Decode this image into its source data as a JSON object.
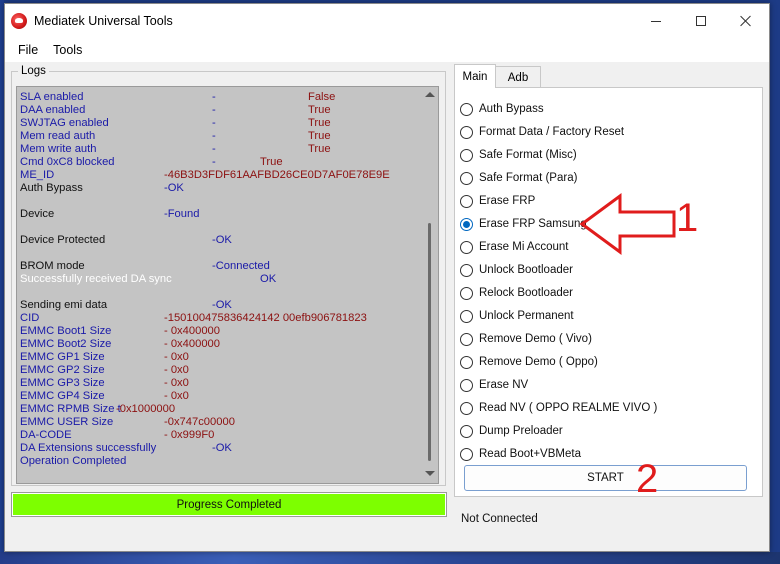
{
  "window": {
    "title": "Mediatek Universal Tools"
  },
  "menu": {
    "items": [
      {
        "label": "File"
      },
      {
        "label": "Tools"
      }
    ]
  },
  "logs": {
    "legend": "Logs",
    "lines": [
      {
        "a": "SLA enabled",
        "b": "-",
        "c": "False",
        "ca": "c-blue",
        "cb": "c-blue",
        "cc": "c-red",
        "xb": 192,
        "xc": 288
      },
      {
        "a": "DAA enabled",
        "b": "-",
        "c": "True",
        "ca": "c-blue",
        "cb": "c-blue",
        "cc": "c-red",
        "xb": 192,
        "xc": 288
      },
      {
        "a": "SWJTAG enabled",
        "b": "-",
        "c": "True",
        "ca": "c-blue",
        "cb": "c-blue",
        "cc": "c-red",
        "xb": 192,
        "xc": 288
      },
      {
        "a": "Mem read auth",
        "b": "-",
        "c": "True",
        "ca": "c-blue",
        "cb": "c-blue",
        "cc": "c-red",
        "xb": 192,
        "xc": 288
      },
      {
        "a": "Mem write auth",
        "b": "-",
        "c": "True",
        "ca": "c-blue",
        "cb": "c-blue",
        "cc": "c-red",
        "xb": 192,
        "xc": 288
      },
      {
        "a": "Cmd 0xC8 blocked",
        "b": "-",
        "c": "True",
        "ca": "c-blue",
        "cb": "c-blue",
        "cc": "c-red",
        "xb": 192,
        "xc": 240
      },
      {
        "a": "ME_ID",
        "b": "-46B3D3FDF61AAFBD26CE0D7AF0E78E9E",
        "c": "",
        "ca": "c-blue",
        "cb": "c-red",
        "cc": "c-red",
        "xb": 144,
        "xc": 0
      },
      {
        "a": "Auth Bypass",
        "b": "-OK",
        "c": "",
        "ca": "c-black",
        "cb": "c-blue",
        "cc": "c-blue",
        "xb": 144,
        "xc": 0
      },
      {
        "a": "",
        "b": "",
        "c": "",
        "ca": "c-black",
        "cb": "c-blue",
        "cc": "c-blue",
        "xb": 144,
        "xc": 0
      },
      {
        "a": "Device",
        "b": "-Found",
        "c": "",
        "ca": "c-black",
        "cb": "c-blue",
        "cc": "c-blue",
        "xb": 144,
        "xc": 0
      },
      {
        "a": "",
        "b": "",
        "c": "",
        "ca": "c-black",
        "cb": "c-blue",
        "cc": "c-blue",
        "xb": 144,
        "xc": 0
      },
      {
        "a": "Device Protected",
        "b": "-OK",
        "c": "",
        "ca": "c-black",
        "cb": "c-blue",
        "cc": "c-blue",
        "xb": 192,
        "xc": 0
      },
      {
        "a": "",
        "b": "",
        "c": "",
        "ca": "c-black",
        "cb": "c-blue",
        "cc": "c-blue",
        "xb": 144,
        "xc": 0
      },
      {
        "a": "BROM mode",
        "b": "-Connected",
        "c": "",
        "ca": "c-black",
        "cb": "c-blue",
        "cc": "c-blue",
        "xb": 192,
        "xc": 0
      },
      {
        "a": "Successfully received DA sync",
        "b": "OK",
        "c": "",
        "ca": "c-white",
        "cb": "c-blue",
        "cc": "c-blue",
        "xb": 240,
        "xc": 0
      },
      {
        "a": "",
        "b": "",
        "c": "",
        "ca": "c-black",
        "cb": "c-blue",
        "cc": "c-blue",
        "xb": 144,
        "xc": 0
      },
      {
        "a": "Sending emi data",
        "b": "-OK",
        "c": "",
        "ca": "c-black",
        "cb": "c-blue",
        "cc": "c-blue",
        "xb": 192,
        "xc": 0
      },
      {
        "a": "CID",
        "b": "-150100475836424142 00efb906781823",
        "c": "",
        "ca": "c-blue",
        "cb": "c-red",
        "cc": "c-red",
        "xb": 144,
        "xc": 0
      },
      {
        "a": "EMMC Boot1 Size",
        "b": "- 0x400000",
        "c": "",
        "ca": "c-blue",
        "cb": "c-red",
        "cc": "c-red",
        "xb": 144,
        "xc": 0
      },
      {
        "a": "EMMC Boot2 Size",
        "b": "- 0x400000",
        "c": "",
        "ca": "c-blue",
        "cb": "c-red",
        "cc": "c-red",
        "xb": 144,
        "xc": 0
      },
      {
        "a": "EMMC GP1 Size",
        "b": "- 0x0",
        "c": "",
        "ca": "c-blue",
        "cb": "c-red",
        "cc": "c-red",
        "xb": 144,
        "xc": 0
      },
      {
        "a": "EMMC GP2 Size",
        "b": "- 0x0",
        "c": "",
        "ca": "c-blue",
        "cb": "c-red",
        "cc": "c-red",
        "xb": 144,
        "xc": 0
      },
      {
        "a": "EMMC GP3 Size",
        "b": "- 0x0",
        "c": "",
        "ca": "c-blue",
        "cb": "c-red",
        "cc": "c-red",
        "xb": 144,
        "xc": 0
      },
      {
        "a": "EMMC GP4 Size",
        "b": "- 0x0",
        "c": "",
        "ca": "c-blue",
        "cb": "c-red",
        "cc": "c-red",
        "xb": 144,
        "xc": 0
      },
      {
        "a": "EMMC RPMB Size t",
        "b": "-0x1000000",
        "c": "",
        "ca": "c-blue",
        "cb": "c-red",
        "cc": "c-red",
        "xb": 96,
        "xc": 0
      },
      {
        "a": "EMMC USER Size",
        "b": "-0x747c00000",
        "c": "",
        "ca": "c-blue",
        "cb": "c-red",
        "cc": "c-red",
        "xb": 144,
        "xc": 0
      },
      {
        "a": "DA-CODE",
        "b": "- 0x999F0",
        "c": "",
        "ca": "c-blue",
        "cb": "c-red",
        "cc": "c-red",
        "xb": 144,
        "xc": 0
      },
      {
        "a": "DA Extensions successfully",
        "b": "-OK",
        "c": "",
        "ca": "c-blue",
        "cb": "c-blue",
        "cc": "c-blue",
        "xb": 192,
        "xc": 0
      },
      {
        "a": "Operation Completed",
        "b": "",
        "c": "",
        "ca": "c-blue",
        "cb": "c-blue",
        "cc": "c-blue",
        "xb": 144,
        "xc": 0
      }
    ]
  },
  "progress": {
    "label": "Progress Completed",
    "value": 1.0,
    "fill_color": "#7dff00"
  },
  "tabs": [
    {
      "label": "Main",
      "active": true
    },
    {
      "label": "Adb",
      "active": false
    }
  ],
  "options": [
    {
      "label": "Auth Bypass",
      "checked": false
    },
    {
      "label": "Format Data / Factory Reset",
      "checked": false
    },
    {
      "label": "Safe Format (Misc)",
      "checked": false
    },
    {
      "label": "Safe Format (Para)",
      "checked": false
    },
    {
      "label": "Erase FRP",
      "checked": false
    },
    {
      "label": "Erase FRP Samsung",
      "checked": true
    },
    {
      "label": "Erase Mi Account",
      "checked": false
    },
    {
      "label": "Unlock Bootloader",
      "checked": false
    },
    {
      "label": "Relock Bootloader",
      "checked": false
    },
    {
      "label": "Unlock Permanent",
      "checked": false
    },
    {
      "label": "Remove Demo ( Vivo)",
      "checked": false
    },
    {
      "label": "Remove Demo ( Oppo)",
      "checked": false
    },
    {
      "label": "Erase NV",
      "checked": false
    },
    {
      "label": "Read NV ( OPPO REALME VIVO )",
      "checked": false
    },
    {
      "label": "Dump Preloader",
      "checked": false
    },
    {
      "label": "Read Boot+VBMeta",
      "checked": false
    }
  ],
  "start_button": {
    "label": "START"
  },
  "status": {
    "text": "Not Connected"
  },
  "annotations": {
    "one": "1",
    "two": "2",
    "color": "#e01c1c"
  }
}
